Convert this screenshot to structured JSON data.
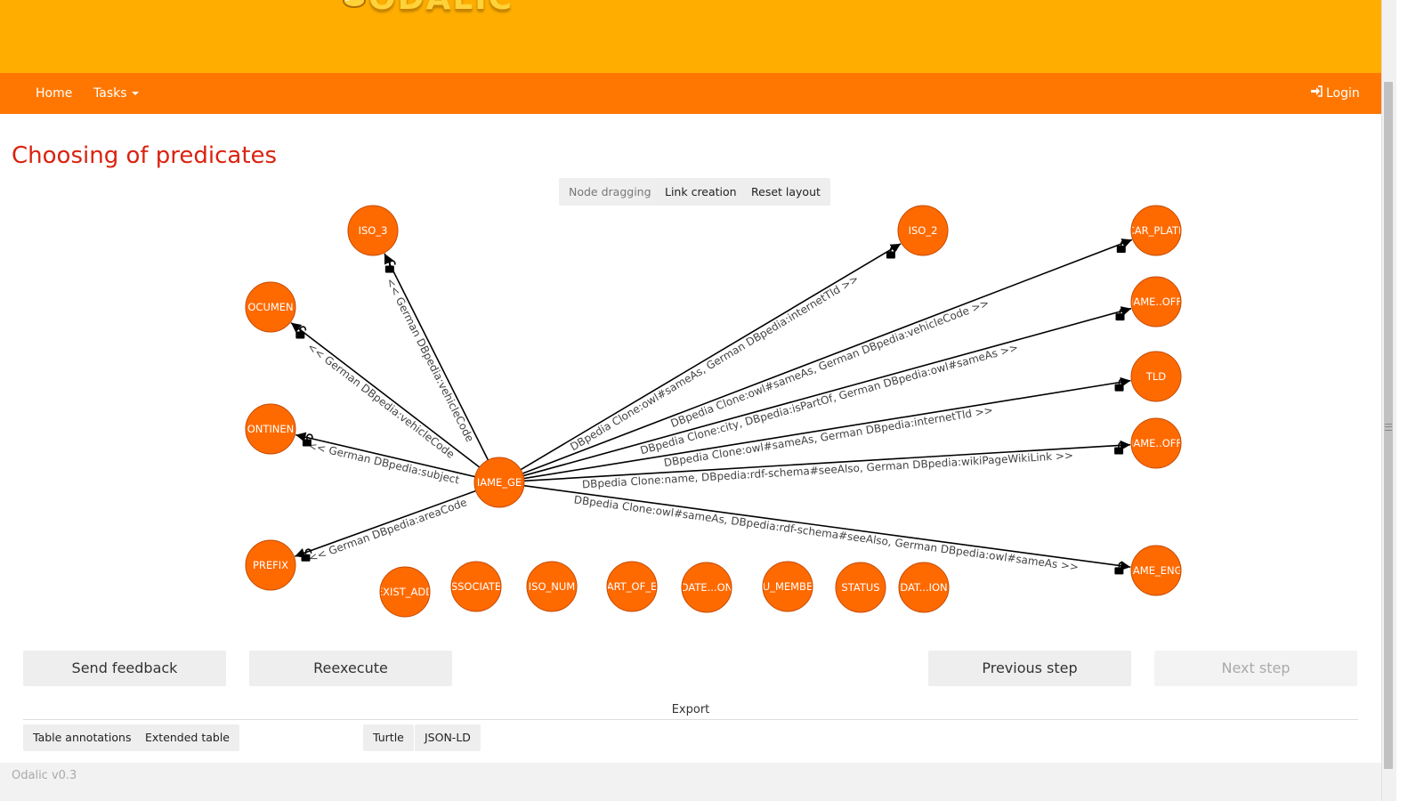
{
  "app": {
    "logo_text": "ODALIC",
    "version": "Odalic v0.3"
  },
  "nav": {
    "home": "Home",
    "tasks": "Tasks",
    "login": "Login"
  },
  "page": {
    "title": "Choosing of predicates"
  },
  "graph_controls": {
    "node_dragging": "Node dragging",
    "link_creation": "Link creation",
    "reset_layout": "Reset layout"
  },
  "graph": {
    "center": "NAME_GEO",
    "center_display": "IAME_GE",
    "nodes": [
      {
        "id": "ISO_3",
        "label": "ISO_3"
      },
      {
        "id": "DOCUMENT",
        "label": "OCUMEN"
      },
      {
        "id": "CONTINENT",
        "label": "ONTINEN"
      },
      {
        "id": "PREFIX",
        "label": "PREFIX"
      },
      {
        "id": "ISO_2",
        "label": "ISO_2"
      },
      {
        "id": "CAR_PLATE",
        "label": "CAR_PLATE"
      },
      {
        "id": "NAME_OFF1",
        "label": "IAME..OFF"
      },
      {
        "id": "TLD",
        "label": "TLD"
      },
      {
        "id": "NAME_OFF2",
        "label": "IAME..OFF"
      },
      {
        "id": "NAME_ENG",
        "label": "IAME_ENG"
      },
      {
        "id": "EXIST_ADD",
        "label": "EXIST_ADD"
      },
      {
        "id": "ASSOCIATE",
        "label": "SSOCIATE"
      },
      {
        "id": "ISO_NUM",
        "label": "ISO_NUM"
      },
      {
        "id": "PART_OF_E",
        "label": "ART_OF_E"
      },
      {
        "id": "DATE_ON",
        "label": "DATE...ON"
      },
      {
        "id": "EU_MEMBER",
        "label": "U_MEMBE"
      },
      {
        "id": "STATUS",
        "label": "STATUS"
      },
      {
        "id": "DATE_ION",
        "label": "DAT...ION"
      }
    ],
    "links": [
      {
        "target": "ISO_3",
        "label": "<< German DBpedia:vehicleCode"
      },
      {
        "target": "DOCUMENT",
        "label": "<< German DBpedia:vehicleCode"
      },
      {
        "target": "CONTINENT",
        "label": "<< German DBpedia:subject"
      },
      {
        "target": "PREFIX",
        "label": "<< German DBpedia:areaCode"
      },
      {
        "target": "ISO_2",
        "label": "DBpedia Clone:owl#sameAs, German DBpedia:internetTld >>"
      },
      {
        "target": "CAR_PLATE",
        "label": "DBpedia Clone:owl#sameAs, German DBpedia:vehicleCode >>"
      },
      {
        "target": "NAME_OFF1",
        "label": "DBpedia Clone:city, DBpedia:isPartOf, German DBpedia:owl#sameAs >>"
      },
      {
        "target": "TLD",
        "label": "DBpedia Clone:owl#sameAs, German DBpedia:internetTld >>"
      },
      {
        "target": "NAME_OFF2",
        "label": "DBpedia Clone:name, DBpedia:rdf-schema#seeAlso, German DBpedia:wikiPageWikiLink >>"
      },
      {
        "target": "NAME_ENG",
        "label": "DBpedia Clone:owl#sameAs, DBpedia:rdf-schema#seeAlso, German DBpedia:owl#sameAs >>"
      }
    ]
  },
  "actions": {
    "send_feedback": "Send feedback",
    "reexecute": "Reexecute",
    "previous_step": "Previous step",
    "next_step": "Next step"
  },
  "export": {
    "label": "Export",
    "table_annotations": "Table annotations",
    "extended_table": "Extended table",
    "turtle": "Turtle",
    "json_ld": "JSON-LD"
  },
  "colors": {
    "banner": "#ffae00",
    "navbar": "#ff7700",
    "node": "#ff6a00",
    "title": "#d9230f"
  }
}
